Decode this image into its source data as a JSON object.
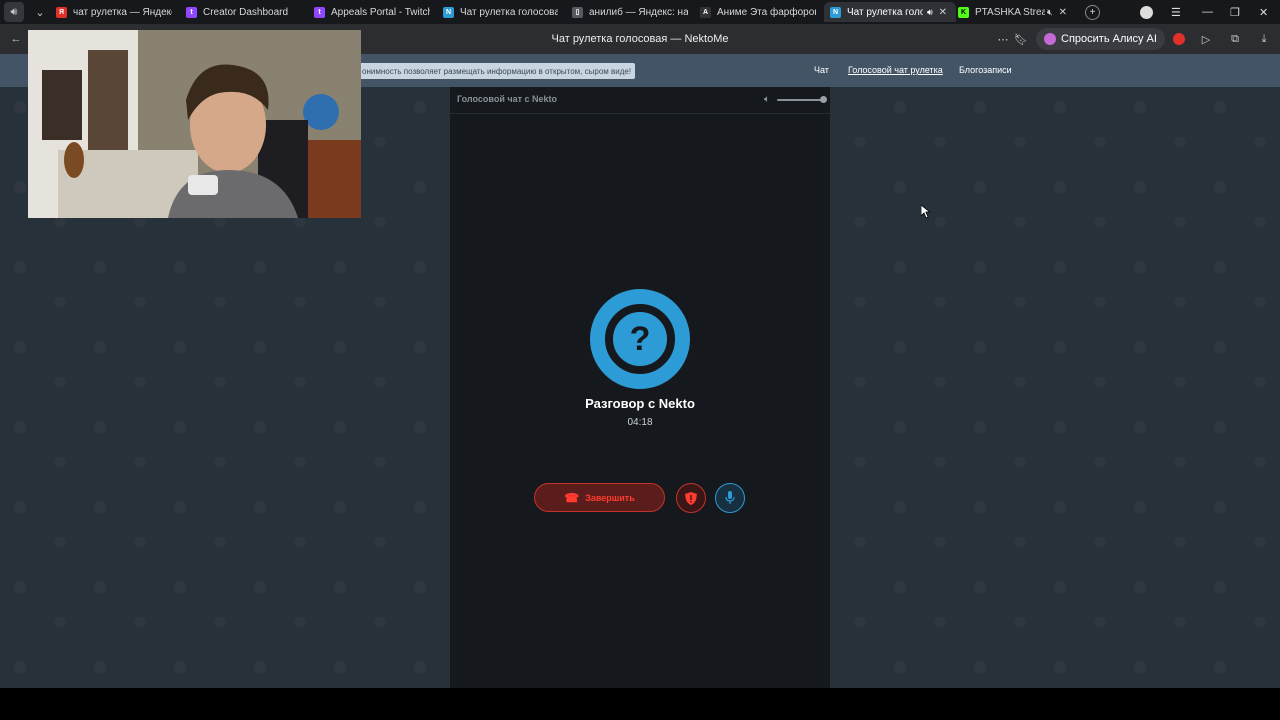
{
  "browser": {
    "tabs": [
      {
        "label": "чат рулетка — Яндекс: н",
        "fav_color": "#e0302a",
        "fav_glyph": "Я"
      },
      {
        "label": "Creator Dashboard",
        "fav_color": "#9146ff",
        "fav_glyph": "t"
      },
      {
        "label": "Appeals Portal - Twitch",
        "fav_color": "#9146ff",
        "fav_glyph": "t"
      },
      {
        "label": "Чат рулетка голосовая",
        "fav_color": "#2d9bd6",
        "fav_glyph": "N"
      },
      {
        "label": "анилиб — Яндекс: нашл",
        "fav_color": "#555a60",
        "fav_glyph": "▯"
      },
      {
        "label": "Аниме Эта фарфорова",
        "fav_color": "#333333",
        "fav_glyph": "A"
      },
      {
        "label": "Чат рулетка голос",
        "fav_color": "#2d9bd6",
        "fav_glyph": "N",
        "active": true
      },
      {
        "label": "PTASHKA Stream",
        "fav_color": "#53fc18",
        "fav_glyph": "K"
      }
    ],
    "page_title": "Чат рулетка голосовая — NektoMe",
    "alice_label": "Спросить Алису AI"
  },
  "site": {
    "notice": "онимность позволяет размещать информацию в открытом, сыром виде!",
    "nav": [
      {
        "label": "Чат",
        "active": false
      },
      {
        "label": "Голосовой чат рулетка",
        "active": true
      },
      {
        "label": "Блогозаписи",
        "active": false
      }
    ]
  },
  "chat": {
    "header_title": "Голосовой чат с Nekto",
    "volume": 1.0,
    "partner_label": "Разговор с Nekto",
    "timer": "04:18",
    "end_label": "Завершить",
    "colors": {
      "accent": "#2d9bd6",
      "danger": "#ff3c2f"
    }
  }
}
